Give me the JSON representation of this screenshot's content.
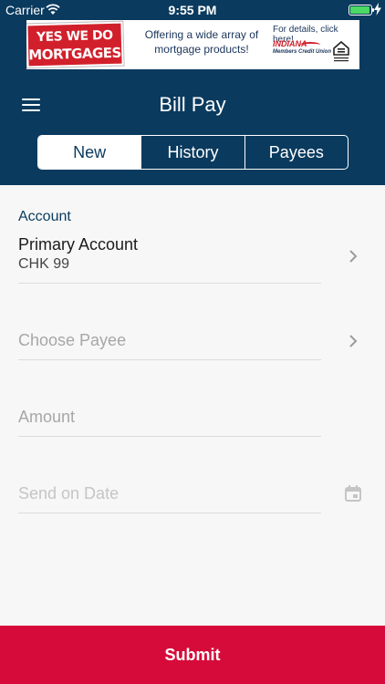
{
  "status_bar": {
    "carrier": "Carrier",
    "time": "9:55 PM",
    "battery_level": 0.95,
    "battery_color": "#4cd964"
  },
  "ad": {
    "badge_line1": "YES WE DO",
    "badge_line2": "MORTGAGES!",
    "text": "Offering a wide array of mortgage products!",
    "details": "For details, click here!",
    "logo_name": "INDIANA",
    "logo_sub": "Members Credit Union"
  },
  "header": {
    "title": "Bill Pay",
    "menu_icon": "hamburger-icon",
    "tabs": [
      {
        "label": "New",
        "active": true
      },
      {
        "label": "History",
        "active": false
      },
      {
        "label": "Payees",
        "active": false
      }
    ]
  },
  "form": {
    "account_label": "Account",
    "account_value": "Primary Account",
    "account_sub": "CHK 99",
    "payee_placeholder": "Choose Payee",
    "amount_placeholder": "Amount",
    "date_placeholder": "Send on Date"
  },
  "submit_label": "Submit",
  "colors": {
    "header": "#0a3a5e",
    "submit": "#d60b3a",
    "ad_red": "#d1202b"
  }
}
